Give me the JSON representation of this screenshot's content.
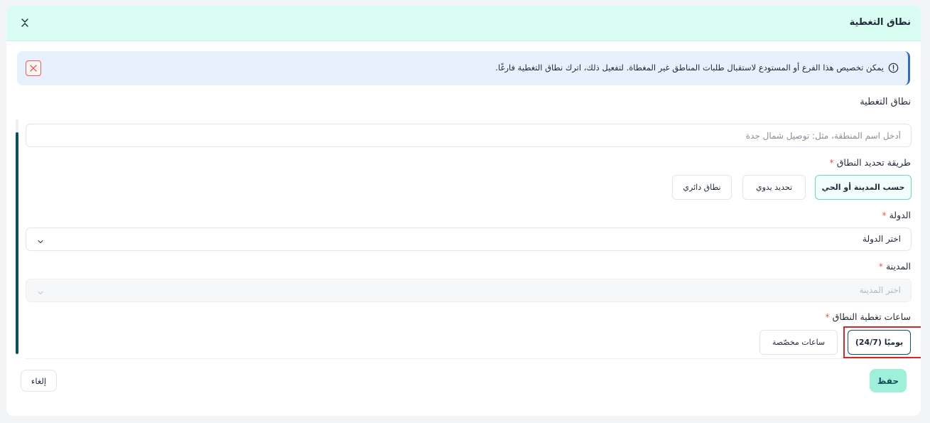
{
  "modal": {
    "title": "نطاق التغطية"
  },
  "alert": {
    "text": "يمكن تخصيص هذا الفرع أو المستودع لاستقبال طلبات المناطق غير المغطاة. لتفعيل ذلك، اترك نطاق التغطية فارغًا."
  },
  "section": {
    "title": "نطاق التغطية"
  },
  "zone_name": {
    "placeholder": "أدخل اسم المنطقة، مثل: توصيل شمال جدة",
    "value": ""
  },
  "method": {
    "label": "طريقة تحديد النطاق",
    "required_mark": "*",
    "options": [
      "حسب المدينة أو الحي",
      "تحديد يدوي",
      "نطاق دائري"
    ],
    "selected": "حسب المدينة أو الحي"
  },
  "country": {
    "label": "الدولة",
    "required_mark": "*",
    "value": "اختر الدولة"
  },
  "city": {
    "label": "المدينة",
    "required_mark": "*",
    "value": "اختر المدينة"
  },
  "hours": {
    "label": "ساعات تغطية النطاق",
    "required_mark": "*",
    "options": [
      "يوميًا (24/7)",
      "ساعات مخصّصة"
    ],
    "selected": "يوميًا (24/7)"
  },
  "footer": {
    "save_label": "حفظ",
    "cancel_label": "إلغاء"
  },
  "colors": {
    "header_bg": "#d9fdf3",
    "alert_bg": "#e8f0fd",
    "accent_dark": "#134e5e",
    "accent_teal": "#6fd6bd",
    "save_bg": "#9ff0d8",
    "required": "#e05a5a",
    "highlight": "#d62828"
  }
}
